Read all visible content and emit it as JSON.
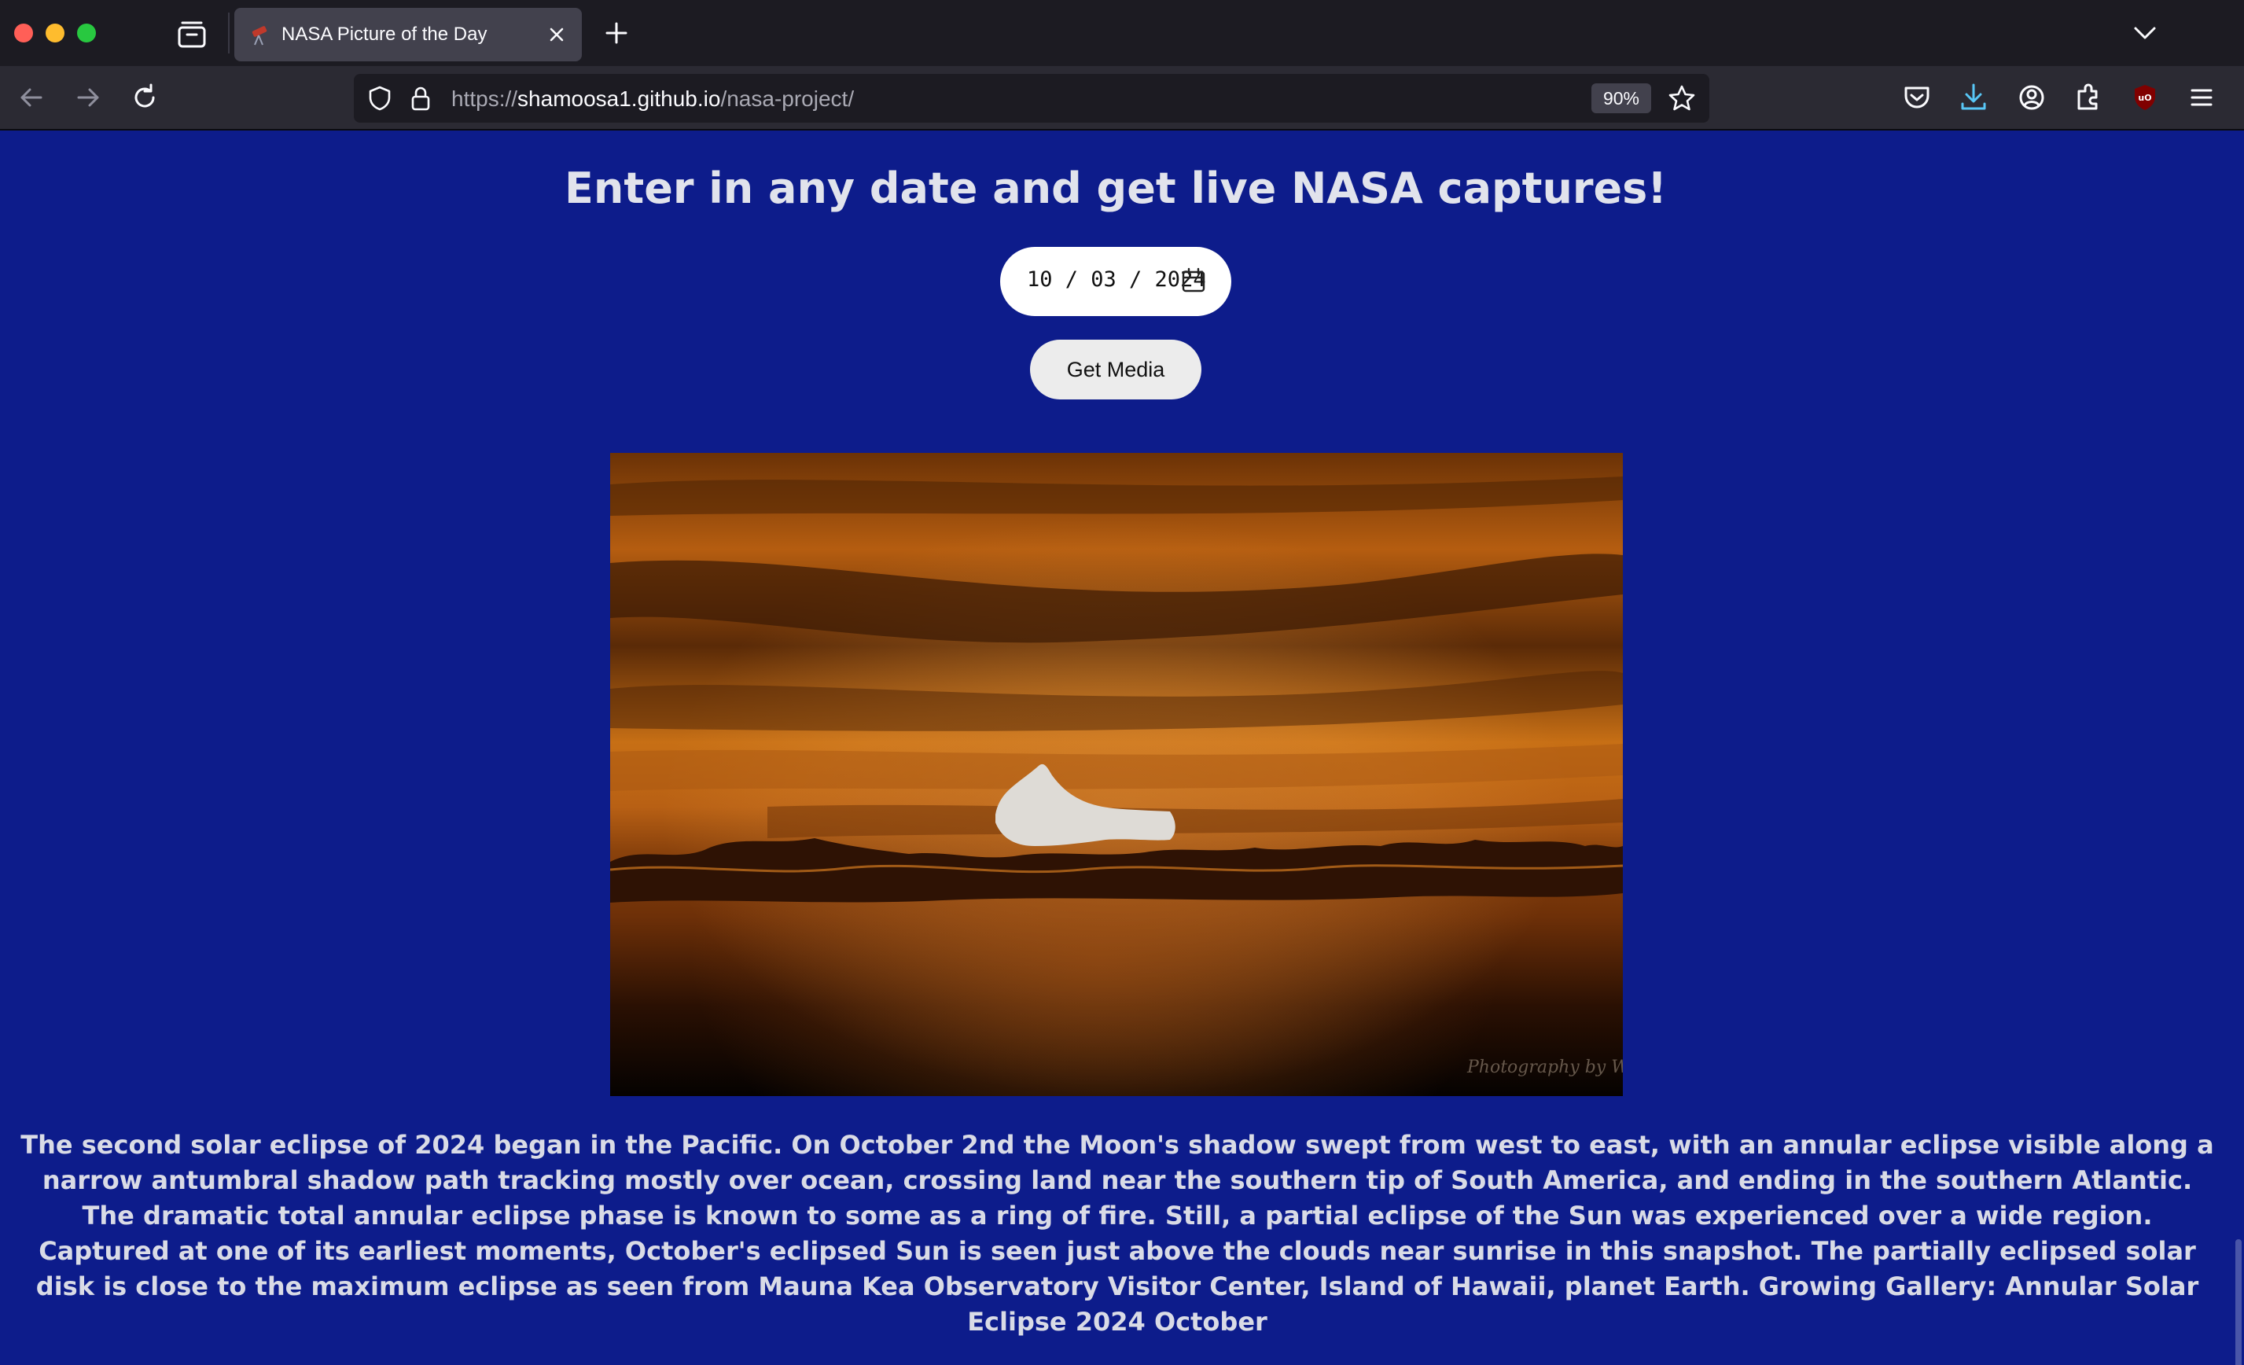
{
  "browser": {
    "tab": {
      "title": "NASA Picture of the Day"
    },
    "url": {
      "scheme": "https://",
      "host": "shamoosa1.github.io",
      "path": "/nasa-project/"
    },
    "zoom": "90%",
    "icons": [
      "tab-overview-icon",
      "close-icon",
      "plus-icon",
      "chevron-down-icon",
      "back-arrow-icon",
      "forward-arrow-icon",
      "reload-icon",
      "shield-icon",
      "lock-icon",
      "star-icon",
      "pocket-icon",
      "download-icon",
      "account-icon",
      "extensions-icon",
      "ublock-icon",
      "hamburger-menu-icon"
    ]
  },
  "page": {
    "heading": "Enter in any date and get live NASA captures!",
    "date_input": {
      "value": "10 / 03 / 2024"
    },
    "get_media_label": "Get Media",
    "image": {
      "watermark": "Photography by Wang Letian"
    },
    "explanation": "The second solar eclipse of 2024 began in the Pacific. On October 2nd the Moon's shadow swept from west to east, with an annular eclipse visible along a narrow antumbral shadow path tracking mostly over ocean, crossing land near the southern tip of South America, and ending in the southern Atlantic. The dramatic total annular eclipse phase is known to some as a ring of fire. Still, a partial eclipse of the Sun was experienced over a wide region. Captured at one of its earliest moments, October's eclipsed Sun is seen just above the clouds near sunrise in this snapshot. The partially eclipsed solar disk is close to the maximum eclipse as seen from Mauna Kea Observatory Visitor Center, Island of Hawaii, planet Earth. Growing Gallery: Annular Solar Eclipse 2024 October"
  },
  "colors": {
    "page_background": "#0d1c8b",
    "chrome_dark": "#1c1b22",
    "toolbar": "#2b2a33",
    "active_tab": "#42414d"
  }
}
